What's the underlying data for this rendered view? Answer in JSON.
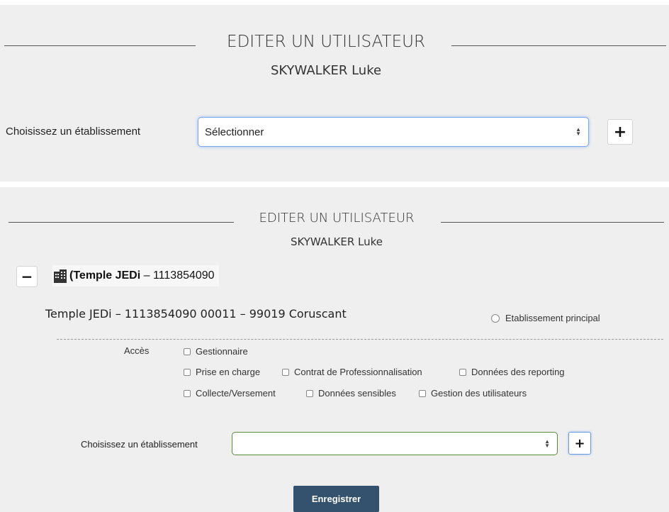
{
  "panel1": {
    "title": "EDITER UN UTILISATEUR",
    "user_name": "SKYWALKER Luke",
    "etab_label": "Choisissez un établissement",
    "select_value": "Sélectionner",
    "add_button": "+"
  },
  "panel2": {
    "title": "EDITER UN UTILISATEUR",
    "user_name": "SKYWALKER Luke",
    "collapse_button": "−",
    "establishment": {
      "paren": "(",
      "name": "Temple JEDi",
      "separator": " – ",
      "code": "1113854090",
      "full_line": "Temple JEDi – 1113854090 00011 – 99019 Coruscant"
    },
    "principal_label": "Etablissement principal",
    "acces_label": "Accès",
    "access_rights": {
      "row1": [
        "Gestionnaire"
      ],
      "row2": [
        "Prise en charge",
        "Contrat de Professionnalisation",
        "Données des reporting"
      ],
      "row3": [
        "Collecte/Versement",
        "Données sensibles",
        "Gestion des utilisateurs"
      ]
    },
    "etab_label": "Choisissez un établissement",
    "select_value": "",
    "add_button": "+",
    "save_button": "Enregistrer"
  },
  "colors": {
    "panel_bg": "#efefef",
    "select_focus_border": "#7aa7e8",
    "select_green_border": "#5a8a3a",
    "save_button_bg": "#34526e"
  }
}
